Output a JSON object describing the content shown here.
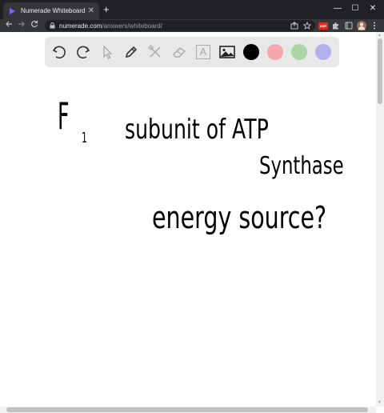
{
  "browser": {
    "tab_title": "Numerade Whiteboard",
    "tab_close": "✕",
    "new_tab": "+",
    "url_host": "numerade.com",
    "url_path": "/answers/whiteboard/",
    "window_controls": [
      "—",
      "☐",
      "✕"
    ],
    "extension_badge": "ABP"
  },
  "whiteboard": {
    "tools": [
      "undo-icon",
      "redo-icon",
      "pointer-icon",
      "pen-icon",
      "tools-icon",
      "eraser-icon",
      "text-icon",
      "image-icon"
    ],
    "text_tool_glyph": "A",
    "colors": [
      "#000000",
      "#f4a6ae",
      "#a9d6a3",
      "#b3b0ee"
    ],
    "handwriting": {
      "line1_a": "F",
      "line1_sub": "1",
      "line1_b": "subunit of ATP",
      "line2": "Synthase",
      "line3": "energy source?"
    }
  }
}
